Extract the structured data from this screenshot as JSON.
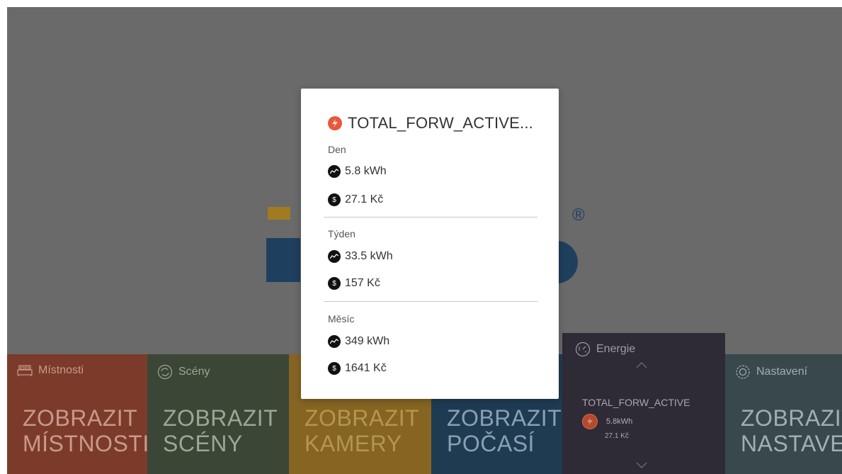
{
  "tiles": {
    "rooms": {
      "label": "Místnosti",
      "action_line1": "ZOBRAZIT",
      "action_line2": "MÍSTNOSTI"
    },
    "scenes": {
      "label": "Scény",
      "action_line1": "ZOBRAZIT",
      "action_line2": "SCÉNY"
    },
    "cameras": {
      "action_line1": "ZOBRAZIT",
      "action_line2": "KAMERY"
    },
    "weather": {
      "action_line1": "ZOBRAZIT",
      "action_line2": "POČASÍ"
    },
    "energy": {
      "label": "Energie",
      "meter_name": "TOTAL_FORW_ACTIVE",
      "value": "5.8kWh",
      "price": "27.1 Kč"
    },
    "settings": {
      "label": "Nastavení",
      "action_line1": "ZOBRAZIT",
      "action_line2": "NASTAVENÍ"
    }
  },
  "modal": {
    "title": "TOTAL_FORW_ACTIVE...",
    "sections": [
      {
        "label": "Den",
        "energy": "5.8 kWh",
        "cost": "27.1 Kč"
      },
      {
        "label": "Týden",
        "energy": "33.5 kWh",
        "cost": "157 Kč"
      },
      {
        "label": "Měsíc",
        "energy": "349 kWh",
        "cost": "1641 Kč"
      }
    ]
  },
  "logo": {
    "registered_mark": "®"
  },
  "colors": {
    "backdrop": "#6a6a6a",
    "rooms_tile": "#7c3b2a",
    "scenes_tile": "#3c4636",
    "cameras_tile": "#866422",
    "weather_tile": "#1f3b52",
    "energy_tile": "#2e2a36",
    "settings_tile": "#39484a",
    "accent": "#e8573c"
  },
  "icons": {
    "rooms": "bed-icon",
    "scenes": "refresh-icon",
    "energy": "gauge-icon",
    "settings": "gear-icon",
    "meter": "lightning-icon",
    "energy_row": "chart-line-icon",
    "cost_row": "dollar-coin-icon"
  }
}
